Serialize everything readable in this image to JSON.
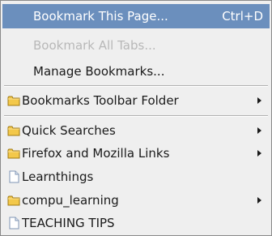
{
  "menu": {
    "bookmark_this_page": {
      "label": "Bookmark This Page...",
      "shortcut": "Ctrl+D",
      "state": "highlighted"
    },
    "bookmark_all_tabs": {
      "label": "Bookmark All Tabs...",
      "state": "disabled"
    },
    "manage_bookmarks": {
      "label": "Manage Bookmarks..."
    },
    "toolbar_folder": {
      "label": "Bookmarks Toolbar Folder",
      "icon": "folder-icon",
      "submenu": true
    },
    "folders": [
      {
        "label": "Quick Searches",
        "icon": "folder-icon",
        "submenu": true
      },
      {
        "label": "Firefox and Mozilla Links",
        "icon": "folder-icon",
        "submenu": true
      },
      {
        "label": "Learnthings",
        "icon": "page-icon",
        "submenu": false
      },
      {
        "label": "compu_learning",
        "icon": "folder-icon",
        "submenu": true
      },
      {
        "label": "TEACHING TIPS",
        "icon": "page-icon",
        "submenu": false
      }
    ]
  },
  "colors": {
    "menu_background": "#efefef",
    "highlight": "#6b8fbd",
    "disabled_text": "#b8b8b8",
    "folder_fill": "#f3c84a",
    "page_icon_outline": "#7f95b5"
  }
}
